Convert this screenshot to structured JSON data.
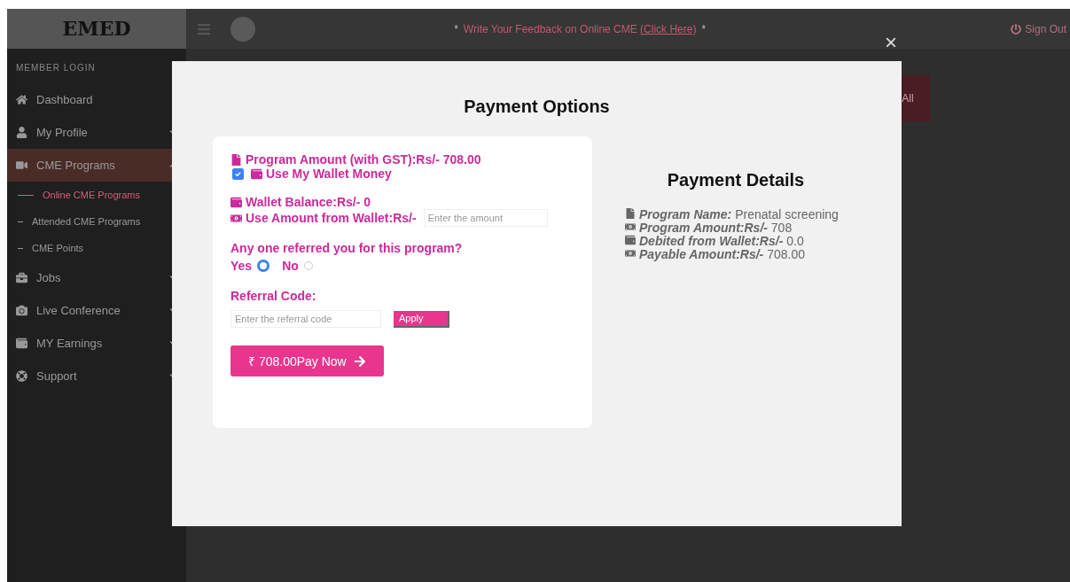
{
  "header": {
    "logo": "EMED",
    "notice": {
      "bullet_left": "*",
      "text": "Write Your Feedback on Online CME ",
      "link": "(Click Here)",
      "bullet_right": "*"
    },
    "sign_out": "Sign Out"
  },
  "sidebar": {
    "section": "MEMBER LOGIN",
    "items": [
      {
        "kind": "home",
        "label": "Dashboard",
        "selected": false
      },
      {
        "kind": "user",
        "label": "My Profile",
        "selected": false,
        "expanded": false
      },
      {
        "kind": "video",
        "label": "CME Programs",
        "selected": true,
        "expanded": true,
        "children": [
          {
            "label": "Online CME Programs",
            "selected": true
          },
          {
            "label": "Attended CME Programs",
            "selected": false
          },
          {
            "label": "CME Points",
            "selected": false
          }
        ]
      },
      {
        "kind": "briefcase",
        "label": "Jobs",
        "selected": false,
        "expanded": false
      },
      {
        "kind": "camera",
        "label": "Live Conference",
        "selected": false,
        "expanded": false
      },
      {
        "kind": "wallet",
        "label": "MY Earnings",
        "selected": false,
        "expanded": false
      },
      {
        "kind": "lifebuoy",
        "label": "Support",
        "selected": false,
        "expanded": false
      }
    ]
  },
  "background_button": "All",
  "modal": {
    "close": "×",
    "title": "Payment Options",
    "options": {
      "program_amount": "Program Amount (with GST):Rs/- 708.00",
      "use_wallet": {
        "label": "Use My Wallet Money",
        "checked": true
      },
      "wallet_balance": "Wallet Balance:Rs/- 0",
      "use_amount": {
        "label": "Use Amount from Wallet:Rs/-",
        "placeholder": "Enter the amount"
      },
      "referral_question": "Any one referred you for this program?",
      "referral_options": [
        {
          "label": "Yes",
          "selected": true
        },
        {
          "label": "No",
          "selected": false
        }
      ],
      "referral_code": {
        "label": "Referral Code:",
        "placeholder": "Enter the referral code",
        "button": "Apply"
      },
      "pay_button": "₹ 708.00Pay Now"
    },
    "details": {
      "title": "Payment Details",
      "items": [
        {
          "kind": "file",
          "label": "Program Name:",
          "value": "Prenatal screening"
        },
        {
          "kind": "money",
          "label": "Program Amount:Rs/-",
          "value": "708"
        },
        {
          "kind": "wallet",
          "label": "Debited from Wallet:Rs/-",
          "value": "0.0"
        },
        {
          "kind": "money",
          "label": "Payable Amount:Rs/-",
          "value": "708.00"
        }
      ]
    }
  }
}
